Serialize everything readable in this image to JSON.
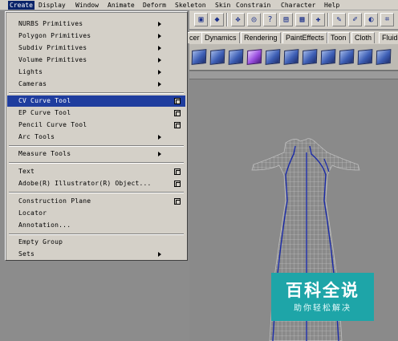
{
  "menubar": {
    "items": [
      {
        "label": "Create"
      },
      {
        "label": "Display"
      },
      {
        "label": "Window"
      },
      {
        "label": "Animate"
      },
      {
        "label": "Deform"
      },
      {
        "label": "Skeleton"
      },
      {
        "label": "Skin"
      },
      {
        "label": "Constrain"
      },
      {
        "label": "Character"
      },
      {
        "label": "Help"
      }
    ]
  },
  "shelf": {
    "tabs": [
      {
        "label": "cer"
      },
      {
        "label": "Dynamics"
      },
      {
        "label": "Rendering"
      },
      {
        "label": "PaintEffects"
      },
      {
        "label": "Toon"
      },
      {
        "label": "Cloth"
      },
      {
        "label": "Fluids"
      }
    ],
    "icons": [
      "cube-icon",
      "poly-cube-icon",
      "cylinder-icon",
      "purple-cube-icon",
      "plane-icon",
      "mesh-icon",
      "cloth-icon",
      "surface-icon",
      "torus-icon",
      "sphere-icon",
      "patch-icon"
    ]
  },
  "create_menu": {
    "items": [
      {
        "label": "NURBS Primitives",
        "submenu": true
      },
      {
        "label": "Polygon Primitives",
        "submenu": true
      },
      {
        "label": "Subdiv Primitives",
        "submenu": true
      },
      {
        "label": "Volume Primitives",
        "submenu": true
      },
      {
        "label": "Lights",
        "submenu": true
      },
      {
        "label": "Cameras",
        "submenu": true
      },
      {
        "label": "CV Curve Tool",
        "option_box": true,
        "highlighted": true
      },
      {
        "label": "EP Curve Tool",
        "option_box": true
      },
      {
        "label": "Pencil Curve Tool",
        "option_box": true
      },
      {
        "label": "Arc Tools",
        "submenu": true
      },
      {
        "label": "Measure Tools",
        "submenu": true
      },
      {
        "label": "Text",
        "option_box": true
      },
      {
        "label": "Adobe(R) Illustrator(R) Object...",
        "option_box": true
      },
      {
        "label": "Construction Plane",
        "option_box": true
      },
      {
        "label": "Locator"
      },
      {
        "label": "Annotation..."
      },
      {
        "label": "Empty Group"
      },
      {
        "label": "Sets",
        "submenu": true
      }
    ]
  },
  "watermark": {
    "title": "百科全说",
    "subtitle": "助你轻松解决"
  },
  "colors": {
    "menu_bg": "#d4d0c8",
    "highlight": "#1f3d9e",
    "watermark": "#1ea5a8",
    "curve": "#1a2aa8",
    "wire": "#c8c8c8"
  }
}
